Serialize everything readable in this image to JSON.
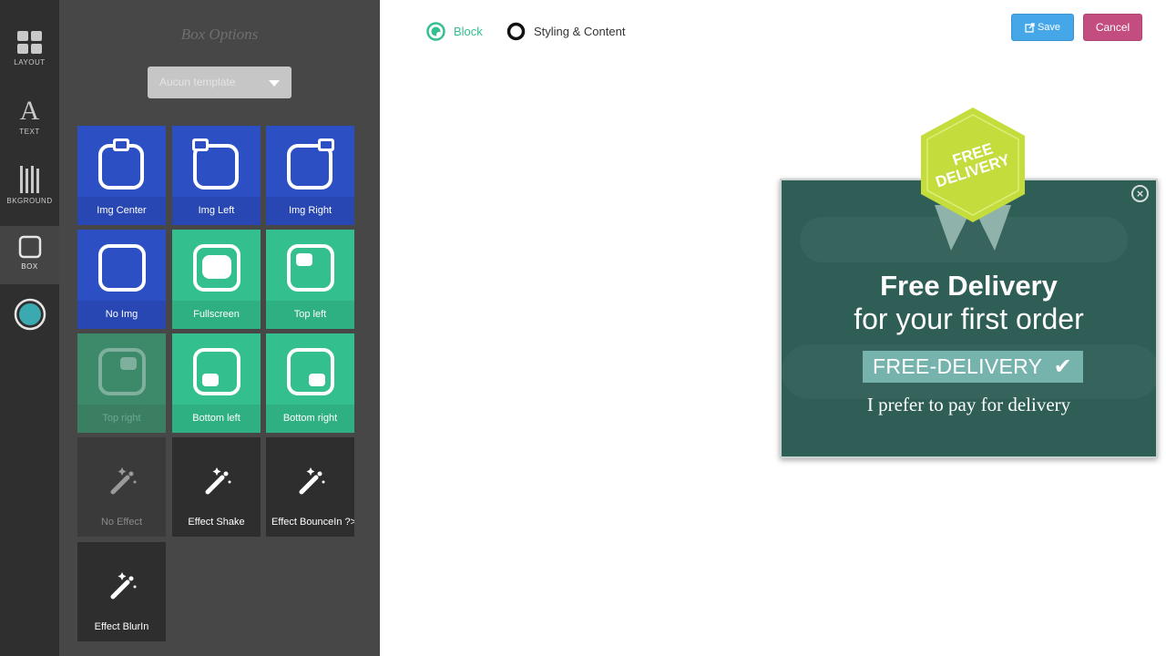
{
  "sidebar": {
    "items": [
      {
        "label": "LAYOUT",
        "icon": "layout-grid-icon"
      },
      {
        "label": "TEXT",
        "icon": "text-a-icon"
      },
      {
        "label": "BKGROUND",
        "icon": "background-bars-icon"
      },
      {
        "label": "BOX",
        "icon": "box-square-icon"
      },
      {
        "label": "",
        "icon": "color-circle-icon"
      }
    ]
  },
  "panel": {
    "title": "Box Options",
    "template_select": {
      "value": "Aucun template"
    },
    "tiles": [
      {
        "label": "Img Center"
      },
      {
        "label": "Img Left"
      },
      {
        "label": "Img Right"
      },
      {
        "label": "No Img"
      },
      {
        "label": "Fullscreen"
      },
      {
        "label": "Top left"
      },
      {
        "label": "Top right"
      },
      {
        "label": "Bottom left"
      },
      {
        "label": "Bottom right"
      },
      {
        "label": "No Effect"
      },
      {
        "label": "Effect Shake"
      },
      {
        "label": "Effect BounceIn ?>"
      },
      {
        "label": "Effect BlurIn"
      }
    ]
  },
  "header": {
    "tab_block": "Block",
    "tab_styling": "Styling & Content",
    "save_label": "Save",
    "cancel_label": "Cancel"
  },
  "popup": {
    "badge_line1": "FREE",
    "badge_line2": "DELIVERY",
    "headline": "Free Delivery",
    "subheadline": "for your first order",
    "code": "FREE-DELIVERY",
    "decline": "I prefer to pay for delivery",
    "close_glyph": "×"
  },
  "colors": {
    "accent_blue": "#2c4fc4",
    "accent_green": "#34c08e",
    "save": "#45a6e8",
    "cancel": "#c24d7e",
    "popup_bg": "#2f5e57",
    "badge": "#c4dc3c"
  }
}
